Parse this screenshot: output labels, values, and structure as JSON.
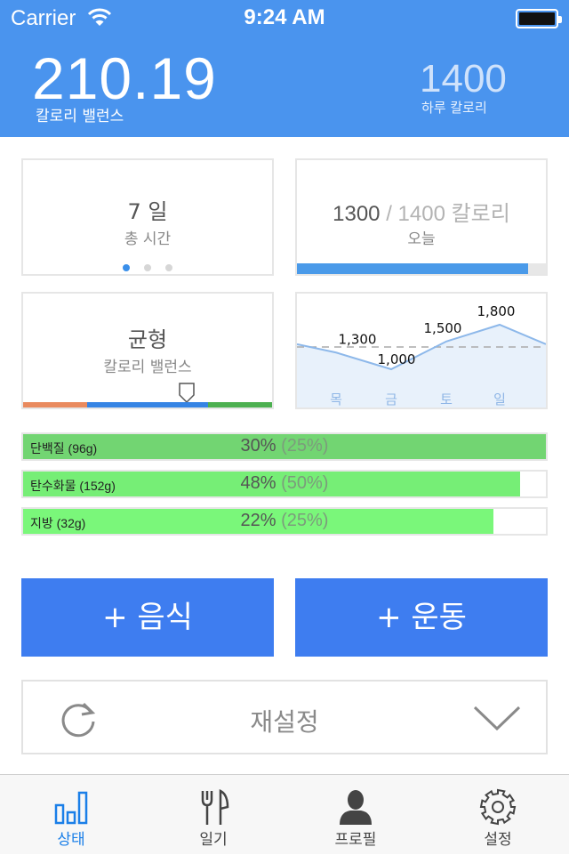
{
  "status_bar": {
    "carrier": "Carrier",
    "time": "9:24 AM"
  },
  "header": {
    "balance_value": "210.19",
    "balance_label": "칼로리 밸런스",
    "daily_value": "1400",
    "daily_label": "하루 칼로리"
  },
  "card_days": {
    "value": "7 일",
    "label": "총 시간",
    "page_count": 3,
    "active_page": 0
  },
  "card_today": {
    "consumed": "1300",
    "separator": "/",
    "goal": "1400 칼로리",
    "label": "오늘",
    "progress": 0.93
  },
  "card_balance": {
    "title": "균형",
    "subtitle": "칼로리 밸런스",
    "segment_colors": [
      "#e98a5e",
      "#3584e4",
      "#4cb050"
    ],
    "marker_fraction": 0.66
  },
  "chart_data": {
    "type": "line",
    "categories": [
      "목",
      "금",
      "토",
      "일"
    ],
    "values": [
      1300,
      1000,
      1500,
      1800
    ],
    "data_labels": [
      "1,300",
      "1,000",
      "1,500",
      "1,800"
    ],
    "baseline": 1400,
    "line_color": "#8db8ea",
    "fill_color": "#e8f1fb"
  },
  "macros": [
    {
      "name": "단백질 (96g)",
      "percent": "30%",
      "goal": "(25%)",
      "fill": 1.0,
      "color": "#72d572"
    },
    {
      "name": "탄수화물 (152g)",
      "percent": "48%",
      "goal": "(50%)",
      "fill": 0.95,
      "color": "#76ee76"
    },
    {
      "name": "지방 (32g)",
      "percent": "22%",
      "goal": "(25%)",
      "fill": 0.9,
      "color": "#7af77a"
    }
  ],
  "buttons": {
    "add_food": "+ 음식",
    "add_exercise": "+ 운동",
    "reset": "재설정"
  },
  "tabs": [
    {
      "label": "상태",
      "icon": "chart-bars-icon",
      "active": true
    },
    {
      "label": "일기",
      "icon": "fork-knife-icon",
      "active": false
    },
    {
      "label": "프로필",
      "icon": "person-icon",
      "active": false
    },
    {
      "label": "설정",
      "icon": "gear-icon",
      "active": false
    }
  ],
  "colors": {
    "header": "#4a94ee",
    "accent": "#3e7df0",
    "tab_active": "#1a7fe8"
  }
}
